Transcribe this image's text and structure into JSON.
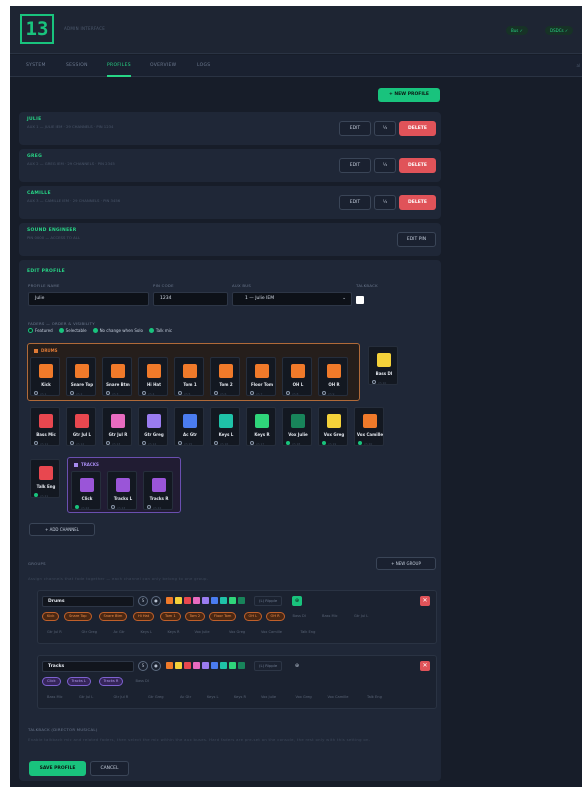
{
  "header": {
    "logo_text": "13",
    "subtitle": "ADMIN INTERFACE",
    "pills": [
      "Bus ✓",
      "DSDCs ✓"
    ]
  },
  "nav": {
    "tabs": [
      "SYSTEM",
      "SESSION",
      "PROFILES",
      "OVERVIEW",
      "LOGS"
    ],
    "active": "PROFILES",
    "right_text": "al"
  },
  "new_profile_label": "+ NEW PROFILE",
  "profiles": [
    {
      "name": "JULIE",
      "meta": "AUX 1 — JULIE IEM · 29 CHANNELS · PIN 1234",
      "edit": "EDIT",
      "extra": "½",
      "del": "DELETE"
    },
    {
      "name": "GREG",
      "meta": "AUX 2 — GREG IEM · 29 CHANNELS · PIN 2345",
      "edit": "EDIT",
      "extra": "½",
      "del": "DELETE"
    },
    {
      "name": "CAMILLE",
      "meta": "AUX 3 — CAMILLE IEM · 29 CHANNELS · PIN 3456",
      "edit": "EDIT",
      "extra": "½",
      "del": "DELETE"
    }
  ],
  "sound_engineer": {
    "name": "SOUND ENGINEER",
    "meta": "PIN 0000 — ACCESS TO ALL",
    "button": "EDIT PIN"
  },
  "edit": {
    "title": "EDIT PROFILE",
    "labels": {
      "name": "PROFILE NAME",
      "pin": "PIN CODE",
      "aux": "AUX BUS",
      "talkback": "TALKBACK"
    },
    "values": {
      "name": "Julie",
      "pin": "1234",
      "aux": "1 — Julie IEM"
    },
    "faders_label": "FADERS — ORDER & VISIBILITY",
    "legend": [
      "Featured",
      "Selectable",
      "No change when Solo",
      "Talk mic"
    ]
  },
  "groups_box": {
    "drums": "DRUMS",
    "tracks": "TRACKS"
  },
  "channels": {
    "drums": [
      {
        "name": "Kick",
        "color": "#f07a2a",
        "sub": "ch 1"
      },
      {
        "name": "Snare Top",
        "color": "#f07a2a",
        "sub": "ch 2"
      },
      {
        "name": "Snare Btm",
        "color": "#f07a2a",
        "sub": "ch 3"
      },
      {
        "name": "Hi Hat",
        "color": "#f07a2a",
        "sub": "ch 4"
      },
      {
        "name": "Tom 1",
        "color": "#f07a2a",
        "sub": "ch 5"
      },
      {
        "name": "Tom 2",
        "color": "#f07a2a",
        "sub": "ch 6"
      },
      {
        "name": "Floor Tom",
        "color": "#f07a2a",
        "sub": "ch 7"
      },
      {
        "name": "OH L",
        "color": "#f07a2a",
        "sub": "ch 8"
      },
      {
        "name": "OH R",
        "color": "#f07a2a",
        "sub": "ch 9"
      }
    ],
    "bass_di": {
      "name": "Bass DI",
      "color": "#f4d13a",
      "sub": "ch 10"
    },
    "row2": [
      {
        "name": "Bass Mic",
        "color": "#e8474f",
        "sub": "ch 11"
      },
      {
        "name": "Gtr Jul L",
        "color": "#e8474f",
        "sub": "ch 12"
      },
      {
        "name": "Gtr Jul R",
        "color": "#e86bc0",
        "sub": "ch 13"
      },
      {
        "name": "Gtr Greg",
        "color": "#9a7cf0",
        "sub": "ch 14"
      },
      {
        "name": "Ac Gtr",
        "color": "#4a7cf0",
        "sub": "ch 15"
      },
      {
        "name": "Keys L",
        "color": "#1fc2a8",
        "sub": "ch 16"
      },
      {
        "name": "Keys R",
        "color": "#2fd57a",
        "sub": "ch 17"
      },
      {
        "name": "Vox Julie",
        "color": "#18845a",
        "sub": "ch 18"
      },
      {
        "name": "Vox Greg",
        "color": "#f4d13a",
        "sub": "ch 19"
      },
      {
        "name": "Vox Camille",
        "color": "#f07a2a",
        "sub": "ch 20"
      }
    ],
    "talk": {
      "name": "Talk Eng",
      "color": "#e8474f",
      "sub": "ch 21"
    },
    "tracks": [
      {
        "name": "Click",
        "color": "#9a55d8",
        "sub": "ch 22"
      },
      {
        "name": "Tracks L",
        "color": "#9a55d8",
        "sub": "ch 23"
      },
      {
        "name": "Tracks R",
        "color": "#9a55d8",
        "sub": "ch 24"
      }
    ]
  },
  "add_channel": "+ ADD CHANNEL",
  "groups": {
    "title": "GROUPS",
    "new": "+ NEW GROUP",
    "desc": "Assign channels that fade together — each channel can only belong to one group.",
    "list": [
      {
        "name": "Drums",
        "ripple": "(L) Ripple",
        "chips_row1": [
          [
            "Kick",
            "o"
          ],
          [
            "Snare Top",
            "o"
          ],
          [
            "Snare Btm",
            "o"
          ],
          [
            "Hi Hat",
            "o"
          ],
          [
            "Tom 1",
            "o"
          ],
          [
            "Tom 2",
            "o"
          ],
          [
            "Floor Tom",
            "o"
          ],
          [
            "OH L",
            "o"
          ],
          [
            "OH R",
            "o"
          ],
          [
            "Bass DI",
            "g"
          ],
          [
            "Bass Mic",
            "g"
          ],
          [
            "Gtr Jul L",
            "g"
          ]
        ],
        "chips_row2": [
          [
            "Gtr Jul R",
            "g"
          ],
          [
            "Gtr Greg",
            "g"
          ],
          [
            "Ac Gtr",
            "g"
          ],
          [
            "Keys L",
            "g"
          ],
          [
            "Keys R",
            "g"
          ],
          [
            "Vox Julie",
            "g"
          ],
          [
            "Vox Greg",
            "g"
          ],
          [
            "Vox Camille",
            "g"
          ],
          [
            "Talk Eng",
            "g"
          ]
        ]
      },
      {
        "name": "Tracks",
        "ripple": "(L) Ripple",
        "chips_row1": [
          [
            "Click",
            "p"
          ],
          [
            "Tracks L",
            "p"
          ],
          [
            "Tracks R",
            "p"
          ],
          [
            "Bass DI",
            "g"
          ]
        ],
        "chips_row2": [
          [
            "Bass Mic",
            "g"
          ],
          [
            "Gtr Jul L",
            "g"
          ],
          [
            "Gtr Jul R",
            "g"
          ],
          [
            "Gtr Greg",
            "g"
          ],
          [
            "Ac Gtr",
            "g"
          ],
          [
            "Keys L",
            "g"
          ],
          [
            "Keys R",
            "g"
          ],
          [
            "Vox Julie",
            "g"
          ],
          [
            "Vox Greg",
            "g"
          ],
          [
            "Vox Camille",
            "g"
          ],
          [
            "Talk Eng",
            "g"
          ]
        ]
      }
    ]
  },
  "talkback": {
    "title": "TALKBACK (DIRECTOR MUSICAL)",
    "desc": "Enable talkback mic and related faders, then select the mic within the aux buses. Hard faders are pre-set on the console, the rest only with this setting on."
  },
  "footer": {
    "save": "SAVE PROFILE",
    "cancel": "CANCEL"
  },
  "palette": [
    "#f07a2a",
    "#f4d13a",
    "#e8474f",
    "#e86bc0",
    "#9a7cf0",
    "#4a7cf0",
    "#1fc2a8",
    "#2fd57a",
    "#18845a"
  ]
}
